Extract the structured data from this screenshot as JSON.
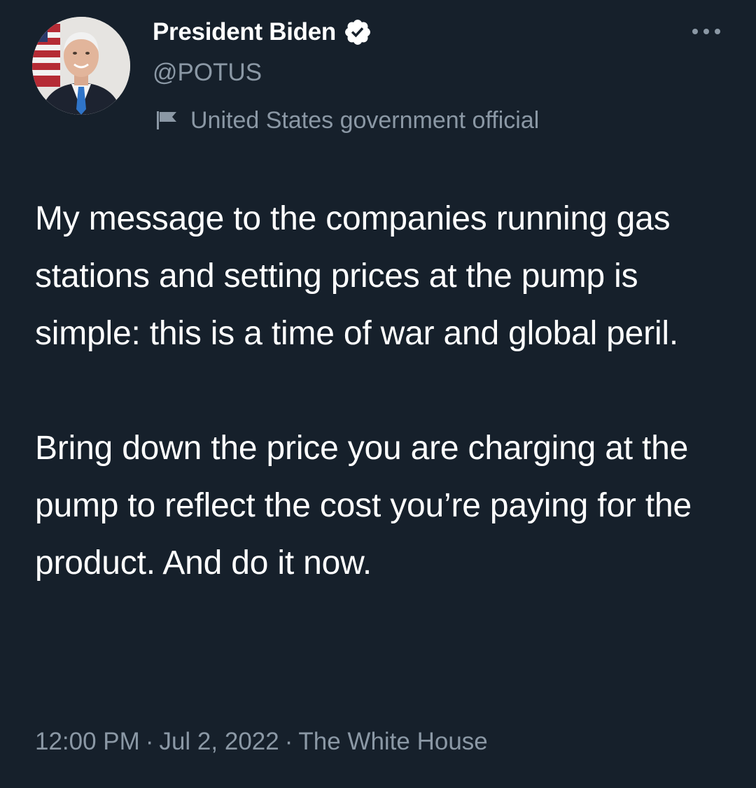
{
  "tweet": {
    "author": {
      "display_name": "President Biden",
      "handle": "@POTUS",
      "verified": true,
      "affiliation_label": "United States government official"
    },
    "text_paragraphs": [
      "My message to the companies running gas stations and setting prices at the pump is simple: this is a time of war and global peril.",
      "Bring down the price you are charging at the pump to reflect the cost you’re paying for the product. And do it now."
    ],
    "timestamp": {
      "time": "12:00 PM",
      "date": "Jul 2, 2022",
      "source": "The White House",
      "separator": "·"
    }
  },
  "icons": {
    "verified_badge": "verified-badge-icon",
    "affiliation": "flag-icon",
    "more": "more-options-icon"
  },
  "colors": {
    "background": "#16202b",
    "primary_text": "#ffffff",
    "secondary_text": "#8b98a5",
    "verified_badge": "#ffffff"
  }
}
